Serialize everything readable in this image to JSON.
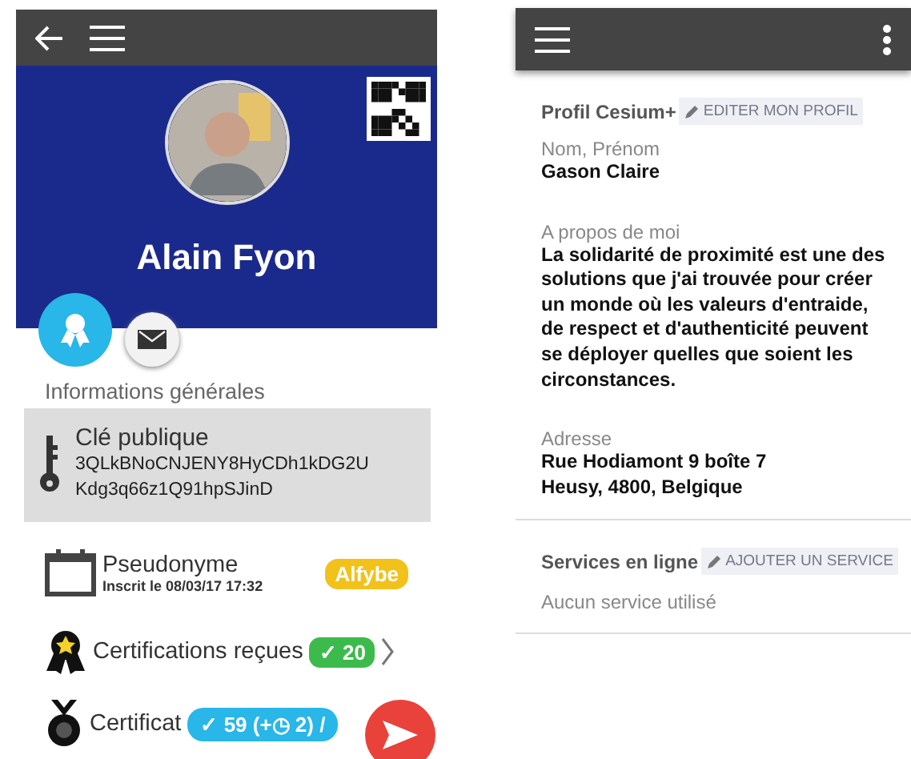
{
  "left_screen": {
    "profile_name": "Alain Fyon",
    "section_title": "Informations générales",
    "public_key": {
      "label": "Clé publique",
      "value_lines": [
        "3QLkBNoCNJENY8HyCDh1kDG2U",
        "Kdg3q66z1Q91hpSJinD"
      ]
    },
    "pseudonym": {
      "label": "Pseudonyme",
      "registered": "Inscrit le 08/03/17 17:32",
      "badge": "Alfybe"
    },
    "certifications_received": {
      "label": "Certifications reçues",
      "badge": "✓ 20"
    },
    "certifications_given": {
      "label": "Certificat",
      "badge": "✓ 59 (+◷ 2) /"
    }
  },
  "right_screen": {
    "profile_section": {
      "title": "Profil Cesium+",
      "edit_button": "EDITER MON PROFIL"
    },
    "fields": [
      {
        "label": "Nom, Prénom",
        "lines": [
          "Gason Claire"
        ]
      },
      {
        "label": "A propos de moi",
        "lines": [
          "La solidarité de proximité est une des solutions que j'ai trouvée pour créer un monde où les valeurs d'entraide, de respect et d'authenticité peuvent se déployer quelles que soient les circonstances."
        ]
      },
      {
        "label": "Adresse",
        "lines": [
          "Rue Hodiamont 9 boîte 7",
          "Heusy, 4800, Belgique"
        ]
      }
    ],
    "services_section": {
      "title": "Services en ligne",
      "add_button": "AJOUTER UN SERVICE",
      "empty_text": "Aucun service utilisé"
    }
  }
}
